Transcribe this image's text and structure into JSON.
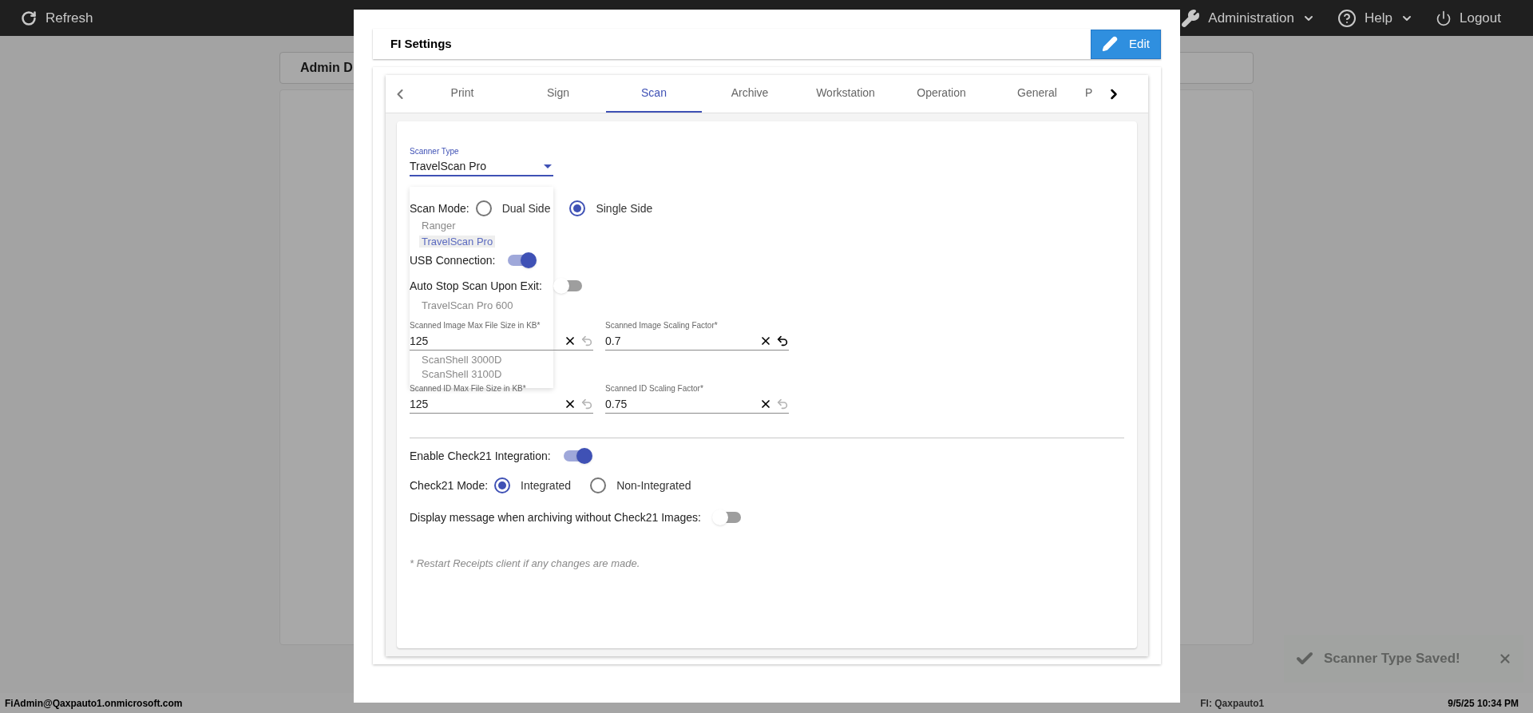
{
  "top_bar": {
    "refresh": "Refresh",
    "menus": [
      {
        "label": "Administration",
        "kind": "admin"
      },
      {
        "label": "Help",
        "kind": "help"
      },
      {
        "label": "Logout",
        "kind": "logout"
      }
    ]
  },
  "background_page": {
    "title": "Admin D"
  },
  "dialog": {
    "title": "FI Settings",
    "edit_button": "Edit",
    "tabs": [
      {
        "label": "Print",
        "selected": false
      },
      {
        "label": "Sign",
        "selected": false
      },
      {
        "label": "Scan",
        "selected": true
      },
      {
        "label": "Archive",
        "selected": false
      },
      {
        "label": "Workstation",
        "selected": false
      },
      {
        "label": "Operation",
        "selected": false
      },
      {
        "label": "General",
        "selected": false
      },
      {
        "label": "P",
        "selected": false
      }
    ],
    "scanner_type": {
      "label": "Scanner Type",
      "value": "TravelScan Pro",
      "expanded": true,
      "options": [
        {
          "label": "Ranger",
          "selected": false
        },
        {
          "label": "TravelScan Pro",
          "selected": true
        },
        {
          "label": "TravelScan Pro 600",
          "selected": false
        },
        {
          "label": "ScanShell 3000D",
          "selected": false
        },
        {
          "label": "ScanShell 3100D",
          "selected": false
        }
      ]
    },
    "scan_mode": {
      "label": "Scan Mode:",
      "options": [
        {
          "label": "Dual Side",
          "selected": false
        },
        {
          "label": "Single Side",
          "selected": true
        }
      ]
    },
    "usb_connection": {
      "label": "USB Connection:",
      "on": true
    },
    "auto_stop": {
      "label": "Auto Stop Scan Upon Exit:",
      "on": false
    },
    "fields": [
      {
        "label": "Scanned Image Max File Size in KB*",
        "value": "125",
        "undo_enabled": false
      },
      {
        "label": "Scanned Image Scaling Factor*",
        "value": "0.7",
        "undo_enabled": true
      },
      {
        "label": "Scanned ID Max File Size in KB*",
        "value": "125",
        "undo_enabled": false
      },
      {
        "label": "Scanned ID Scaling Factor*",
        "value": "0.75",
        "undo_enabled": false
      }
    ],
    "check21": {
      "label": "Enable Check21 Integration:",
      "on": true
    },
    "check21_mode": {
      "label": "Check21 Mode:",
      "options": [
        {
          "label": "Integrated",
          "selected": true
        },
        {
          "label": "Non-Integrated",
          "selected": false
        }
      ]
    },
    "display_message": {
      "label": "Display message when archiving without Check21 Images:",
      "on": false
    },
    "note": "* Restart Receipts client if any changes are made."
  },
  "toast": {
    "message": "Scanner Type Saved!"
  },
  "status_bar": {
    "user": "FiAdmin@Qaxpauto1.onmicrosoft.com",
    "fi": "FI: Qaxpauto1",
    "datetime": "9/5/25 10:34 PM"
  }
}
